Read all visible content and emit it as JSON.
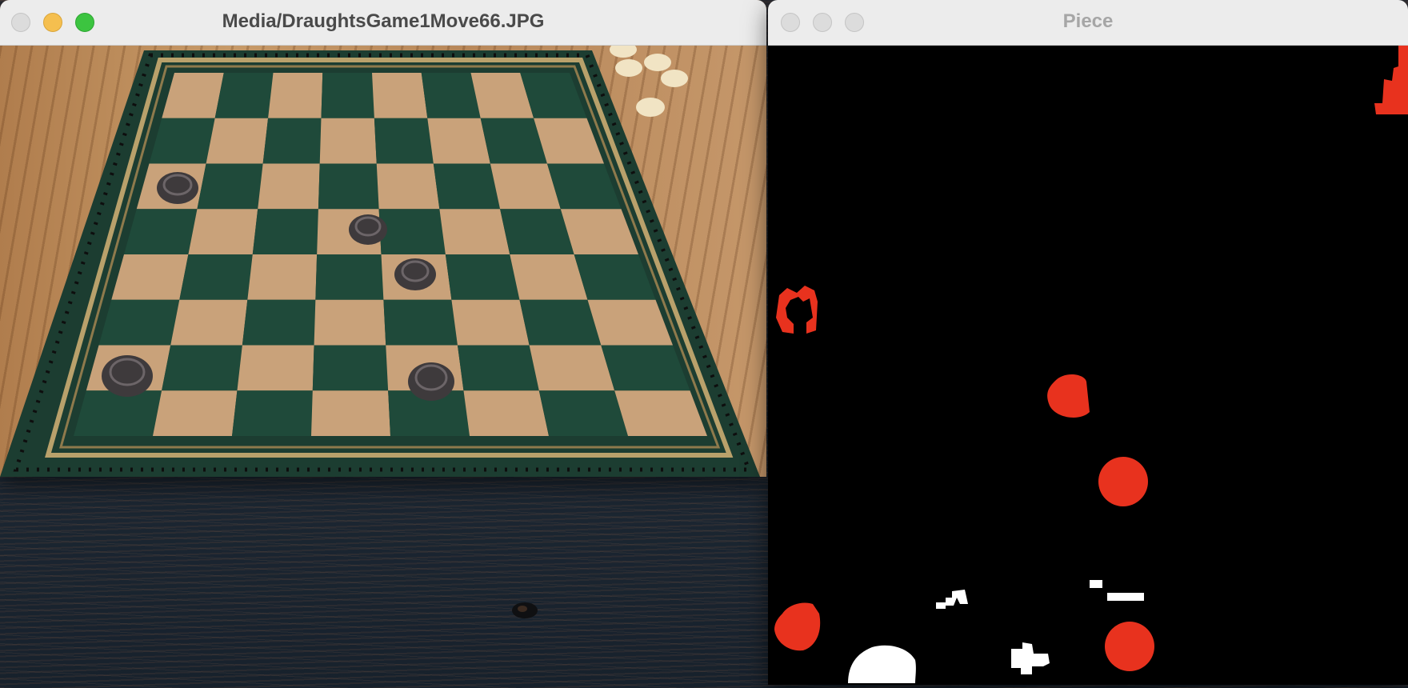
{
  "desktop": {
    "background": "ocean-waves"
  },
  "windows": [
    {
      "title": "Media/DraughtsGame1Move66.JPG",
      "active": true,
      "content": "photo of draughts board with dark pieces",
      "colors": {
        "board_dark": "#1f4a3a",
        "board_light": "#c9a27a",
        "piece": "#4a4446"
      }
    },
    {
      "title": "Piece",
      "active": false,
      "content": "binary mask of detected pieces",
      "colors": {
        "mask_piece": "#e8321e",
        "mask_other": "#ffffff",
        "background": "#000000"
      }
    }
  ],
  "icons": {
    "close": "close-icon",
    "minimize": "minimize-icon",
    "zoom": "zoom-icon"
  }
}
